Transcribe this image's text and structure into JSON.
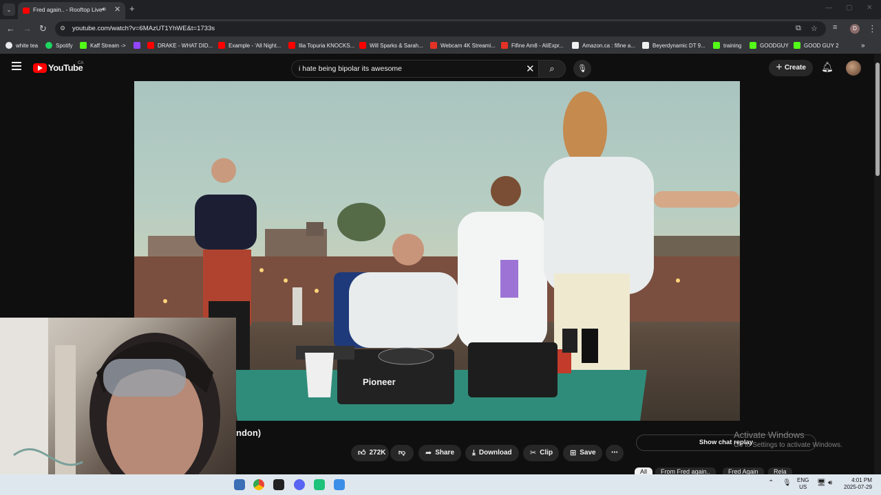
{
  "browser": {
    "tab_title": "Fred again.. - Rooftop Live",
    "url": "youtube.com/watch?v=6MAzUT1YhWE&t=1733s",
    "profile_initial": "D"
  },
  "bookmarks": [
    {
      "label": "white tea",
      "color": "#e8eaed"
    },
    {
      "label": "Spotify",
      "color": "#1ed760"
    },
    {
      "label": "Kaff Stream ->",
      "color": "#53fc18"
    },
    {
      "label": "",
      "color": "#9146ff"
    },
    {
      "label": "DRAKE - WHAT DID...",
      "color": "#ff0000"
    },
    {
      "label": "Example - 'All Night...",
      "color": "#ff0000"
    },
    {
      "label": "Ilia Topuria KNOCKS...",
      "color": "#ff0000"
    },
    {
      "label": "Will Sparks & Sarah...",
      "color": "#ff0000"
    },
    {
      "label": "Webcam 4K Streami...",
      "color": "#e43225"
    },
    {
      "label": "Fifine Am8 - AliExpr...",
      "color": "#e43225"
    },
    {
      "label": "Amazon.ca : fifine a...",
      "color": "#f0f0f0"
    },
    {
      "label": "Beyerdynamic DT 9...",
      "color": "#f0f0f0"
    },
    {
      "label": "training",
      "color": "#53fc18"
    },
    {
      "label": "GOODGUY",
      "color": "#53fc18"
    },
    {
      "label": "GOOD GUY 2",
      "color": "#53fc18"
    }
  ],
  "youtube": {
    "logo_text": "YouTube",
    "region": "CA",
    "search_query": "i hate being bipolar its awesome",
    "create_label": "Create"
  },
  "video": {
    "title_fragment": "ndon)",
    "likes": "272K",
    "share_label": "Share",
    "download_label": "Download",
    "clip_label": "Clip",
    "save_label": "Save",
    "pioneer_label": "Pioneer"
  },
  "sidebar": {
    "chat_replay_label": "Show chat replay",
    "chips": [
      "All",
      "From Fred again..",
      "Fred Again",
      "Rela"
    ]
  },
  "watermark": {
    "line1": "Activate Windows",
    "line2": "Go to Settings to activate Windows."
  },
  "taskbar": {
    "lang": "ENG",
    "region": "US",
    "time": "4:01 PM",
    "date": "2025-07-29"
  }
}
